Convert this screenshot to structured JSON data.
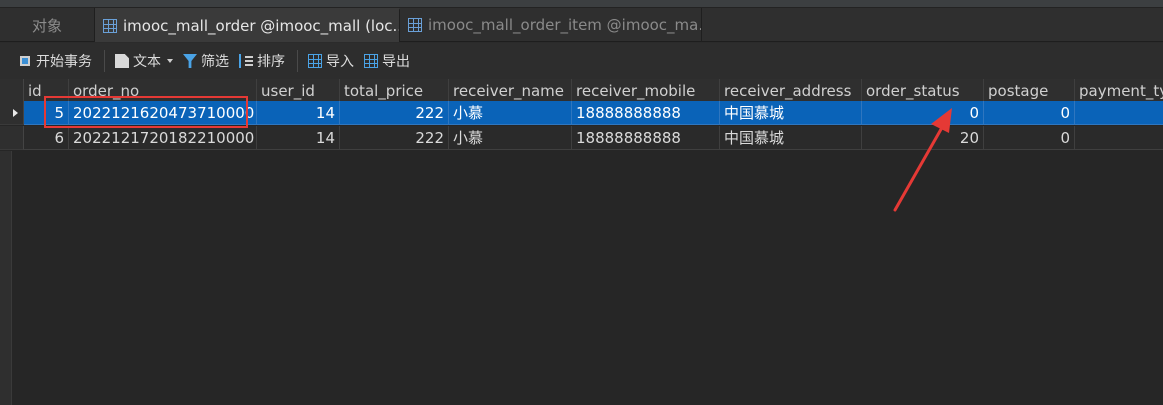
{
  "tabs": {
    "objects_label": "对象",
    "active_label": "imooc_mall_order @imooc_mall (loc...",
    "inactive_label": "imooc_mall_order_item @imooc_ma..."
  },
  "toolbar": {
    "begin_transaction": "开始事务",
    "text": "文本",
    "filter": "筛选",
    "sort": "排序",
    "import": "导入",
    "export": "导出"
  },
  "table": {
    "columns": [
      "id",
      "order_no",
      "user_id",
      "total_price",
      "receiver_name",
      "receiver_mobile",
      "receiver_address",
      "order_status",
      "postage",
      "payment_ty"
    ],
    "rows": [
      [
        "5",
        "2022121620473710000",
        "14",
        "222",
        "小慕",
        "18888888888",
        "中国慕城",
        "0",
        "0",
        ""
      ],
      [
        "6",
        "2022121720182210000",
        "14",
        "222",
        "小慕",
        "18888888888",
        "中国慕城",
        "20",
        "0",
        ""
      ]
    ]
  },
  "colors": {
    "selection": "#0a63b8",
    "annotation": "#e53935"
  }
}
